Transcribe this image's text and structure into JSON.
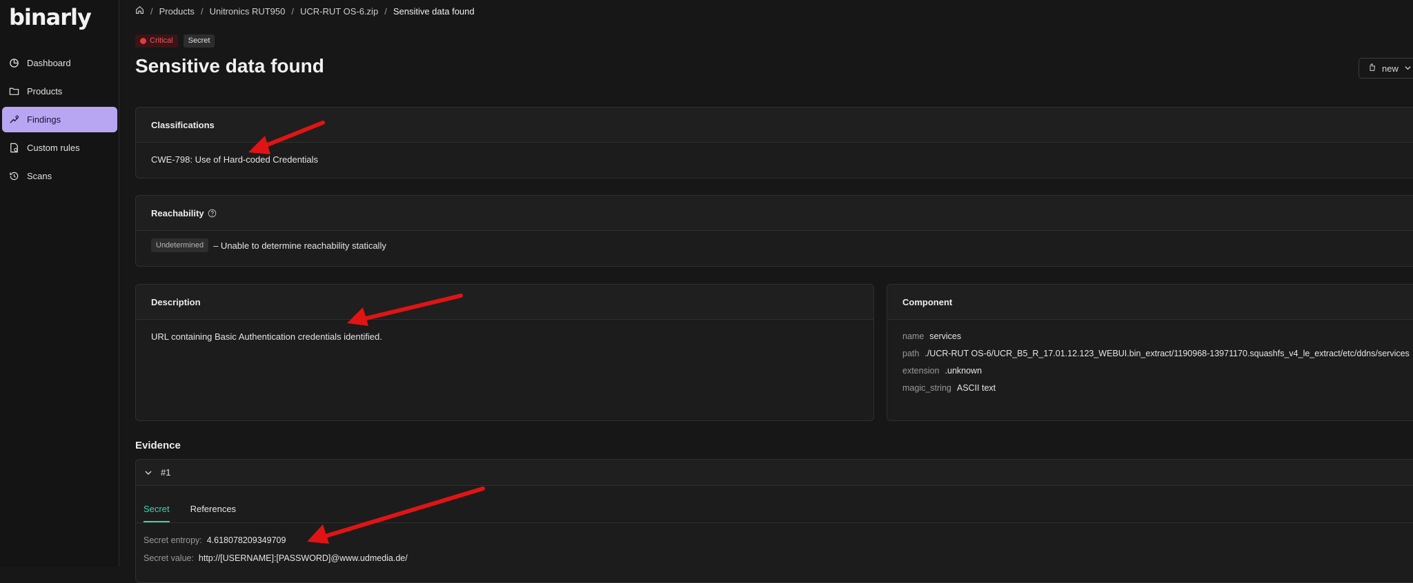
{
  "app": {
    "logo": "binarly"
  },
  "sidebar": {
    "items": [
      {
        "label": "Dashboard",
        "icon": "dashboard-icon",
        "active": false
      },
      {
        "label": "Products",
        "icon": "folder-icon",
        "active": false
      },
      {
        "label": "Findings",
        "icon": "findings-icon",
        "active": true
      },
      {
        "label": "Custom rules",
        "icon": "custom-rules-icon",
        "active": false
      },
      {
        "label": "Scans",
        "icon": "history-icon",
        "active": false
      }
    ]
  },
  "breadcrumb": {
    "items": [
      "Products",
      "Unitronics RUT950",
      "UCR-RUT OS-6.zip"
    ],
    "current": "Sensitive data found"
  },
  "tags": {
    "severity": "Critical",
    "type": "Secret"
  },
  "page_title": "Sensitive data found",
  "status_button": {
    "label": "new"
  },
  "classifications": {
    "title": "Classifications",
    "value": "CWE-798: Use of Hard-coded Credentials"
  },
  "reachability": {
    "title": "Reachability",
    "badge": "Undetermined",
    "text": "– Unable to determine reachability statically"
  },
  "description": {
    "title": "Description",
    "text": "URL containing Basic Authentication credentials identified."
  },
  "component": {
    "title": "Component",
    "fields": [
      {
        "key": "name",
        "value": "services"
      },
      {
        "key": "path",
        "value": "./UCR-RUT OS-6/UCR_B5_R_17.01.12.123_WEBUI.bin_extract/1190968-13971170.squashfs_v4_le_extract/etc/ddns/services"
      },
      {
        "key": "extension",
        "value": ".unknown"
      },
      {
        "key": "magic_string",
        "value": "ASCII text"
      }
    ]
  },
  "evidence": {
    "title": "Evidence",
    "item_label": "#1",
    "tabs": [
      "Secret",
      "References"
    ],
    "active_tab": "Secret",
    "rows": [
      {
        "key": "Secret entropy",
        "value": "4.618078209349709"
      },
      {
        "key": "Secret value",
        "value": "http://[USERNAME]:[PASSWORD]@www.udmedia.de/"
      }
    ]
  },
  "colors": {
    "accent_active_nav": "#b8a6f2",
    "critical": "#e23c3c",
    "tab_active": "#3fd3b0",
    "annotation_arrow": "#e01414"
  }
}
